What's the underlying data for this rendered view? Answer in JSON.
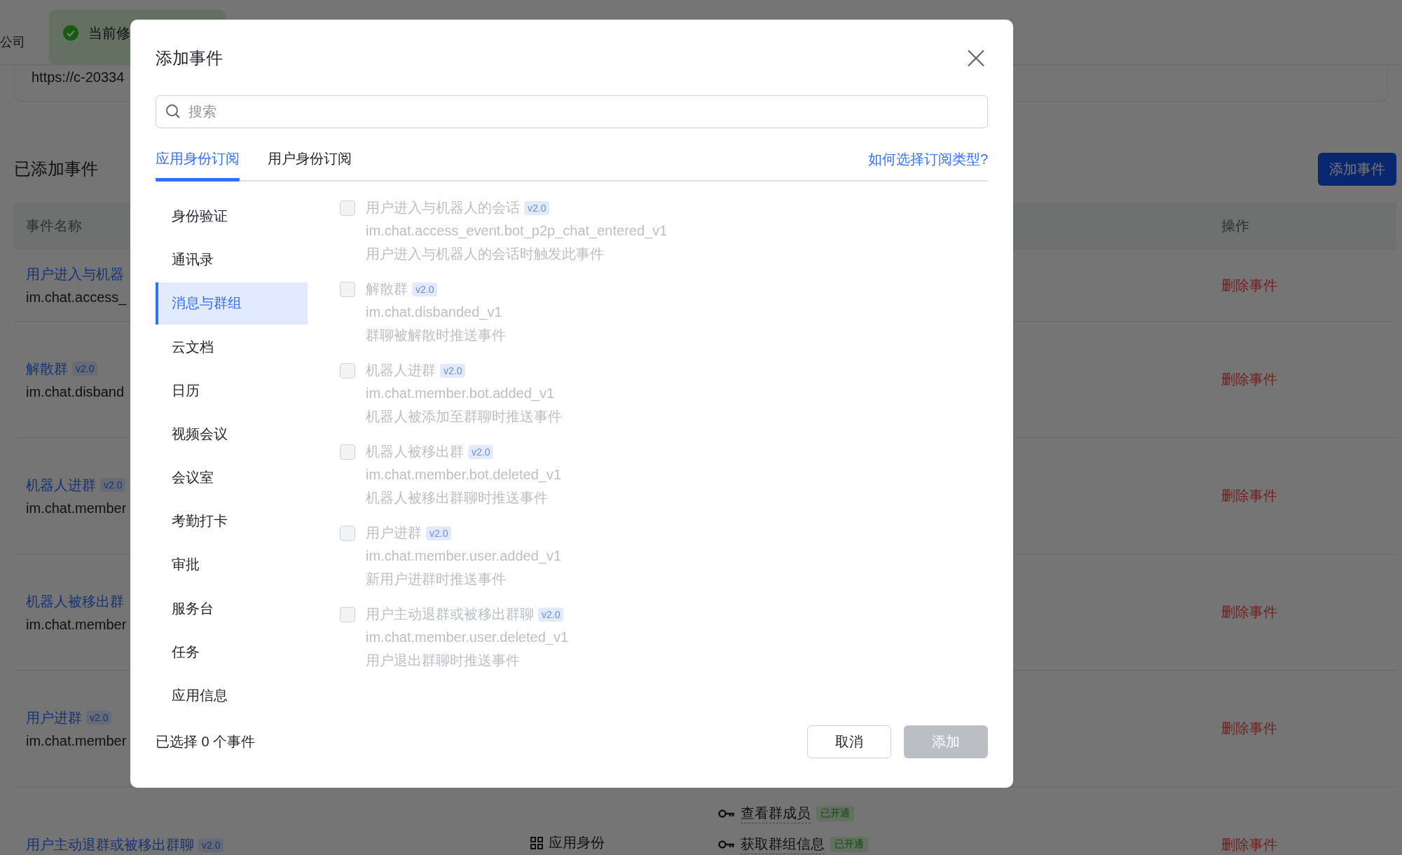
{
  "background": {
    "company_fragment": "公司",
    "toast": {
      "text": "当前修"
    },
    "url_field": {
      "value": "https://c-20334"
    },
    "section_title": "已添加事件",
    "add_button": "添加事件",
    "table": {
      "columns": [
        "事件名称",
        "操作"
      ],
      "rows": [
        {
          "name": "用户进入与机器",
          "code": "im.chat.access_",
          "action": "删除事件"
        },
        {
          "name": "解散群",
          "badge": "v2.0",
          "code": "im.chat.disband",
          "action": "删除事件"
        },
        {
          "name": "机器人进群",
          "badge": "v2.0",
          "code": "im.chat.member",
          "action": "删除事件"
        },
        {
          "name": "机器人被移出群",
          "code": "im.chat.member",
          "action": "删除事件"
        },
        {
          "name": "用户进群",
          "badge": "v2.0",
          "code": "im.chat.member",
          "action": "删除事件"
        },
        {
          "name": "用户主动退群或被移出群聊",
          "badge": "v2.0",
          "identity": "应用身份",
          "permissions": [
            {
              "label": "查看群成员",
              "status": "已开通"
            },
            {
              "label": "获取群组信息",
              "status": "已开通"
            }
          ],
          "action": "删除事件"
        }
      ]
    }
  },
  "dialog": {
    "title": "添加事件",
    "search": {
      "placeholder": "搜索"
    },
    "tabs": [
      {
        "label": "应用身份订阅",
        "selected": true
      },
      {
        "label": "用户身份订阅",
        "selected": false
      }
    ],
    "help_link": "如何选择订阅类型?",
    "categories": [
      {
        "label": "身份验证",
        "selected": false
      },
      {
        "label": "通讯录",
        "selected": false
      },
      {
        "label": "消息与群组",
        "selected": true
      },
      {
        "label": "云文档",
        "selected": false
      },
      {
        "label": "日历",
        "selected": false
      },
      {
        "label": "视频会议",
        "selected": false
      },
      {
        "label": "会议室",
        "selected": false
      },
      {
        "label": "考勤打卡",
        "selected": false
      },
      {
        "label": "审批",
        "selected": false
      },
      {
        "label": "服务台",
        "selected": false
      },
      {
        "label": "任务",
        "selected": false
      },
      {
        "label": "应用信息",
        "selected": false
      }
    ],
    "events": [
      {
        "title": "用户进入与机器人的会话",
        "badge": "v2.0",
        "code": "im.chat.access_event.bot_p2p_chat_entered_v1",
        "description": "用户进入与机器人的会话时触发此事件",
        "checked": false,
        "disabled": true
      },
      {
        "title": "解散群",
        "badge": "v2.0",
        "code": "im.chat.disbanded_v1",
        "description": "群聊被解散时推送事件",
        "checked": false,
        "disabled": true
      },
      {
        "title": "机器人进群",
        "badge": "v2.0",
        "code": "im.chat.member.bot.added_v1",
        "description": "机器人被添加至群聊时推送事件",
        "checked": false,
        "disabled": true
      },
      {
        "title": "机器人被移出群",
        "badge": "v2.0",
        "code": "im.chat.member.bot.deleted_v1",
        "description": "机器人被移出群聊时推送事件",
        "checked": false,
        "disabled": true
      },
      {
        "title": "用户进群",
        "badge": "v2.0",
        "code": "im.chat.member.user.added_v1",
        "description": "新用户进群时推送事件",
        "checked": false,
        "disabled": true
      },
      {
        "title": "用户主动退群或被移出群聊",
        "badge": "v2.0",
        "code": "im.chat.member.user.deleted_v1",
        "description": "用户退出群聊时推送事件",
        "checked": false,
        "disabled": true
      }
    ],
    "selection_summary": "已选择 0 个事件",
    "buttons": [
      {
        "label": "取消",
        "kind": "secondary",
        "disabled": false
      },
      {
        "label": "添加",
        "kind": "primary",
        "disabled": true
      }
    ]
  }
}
